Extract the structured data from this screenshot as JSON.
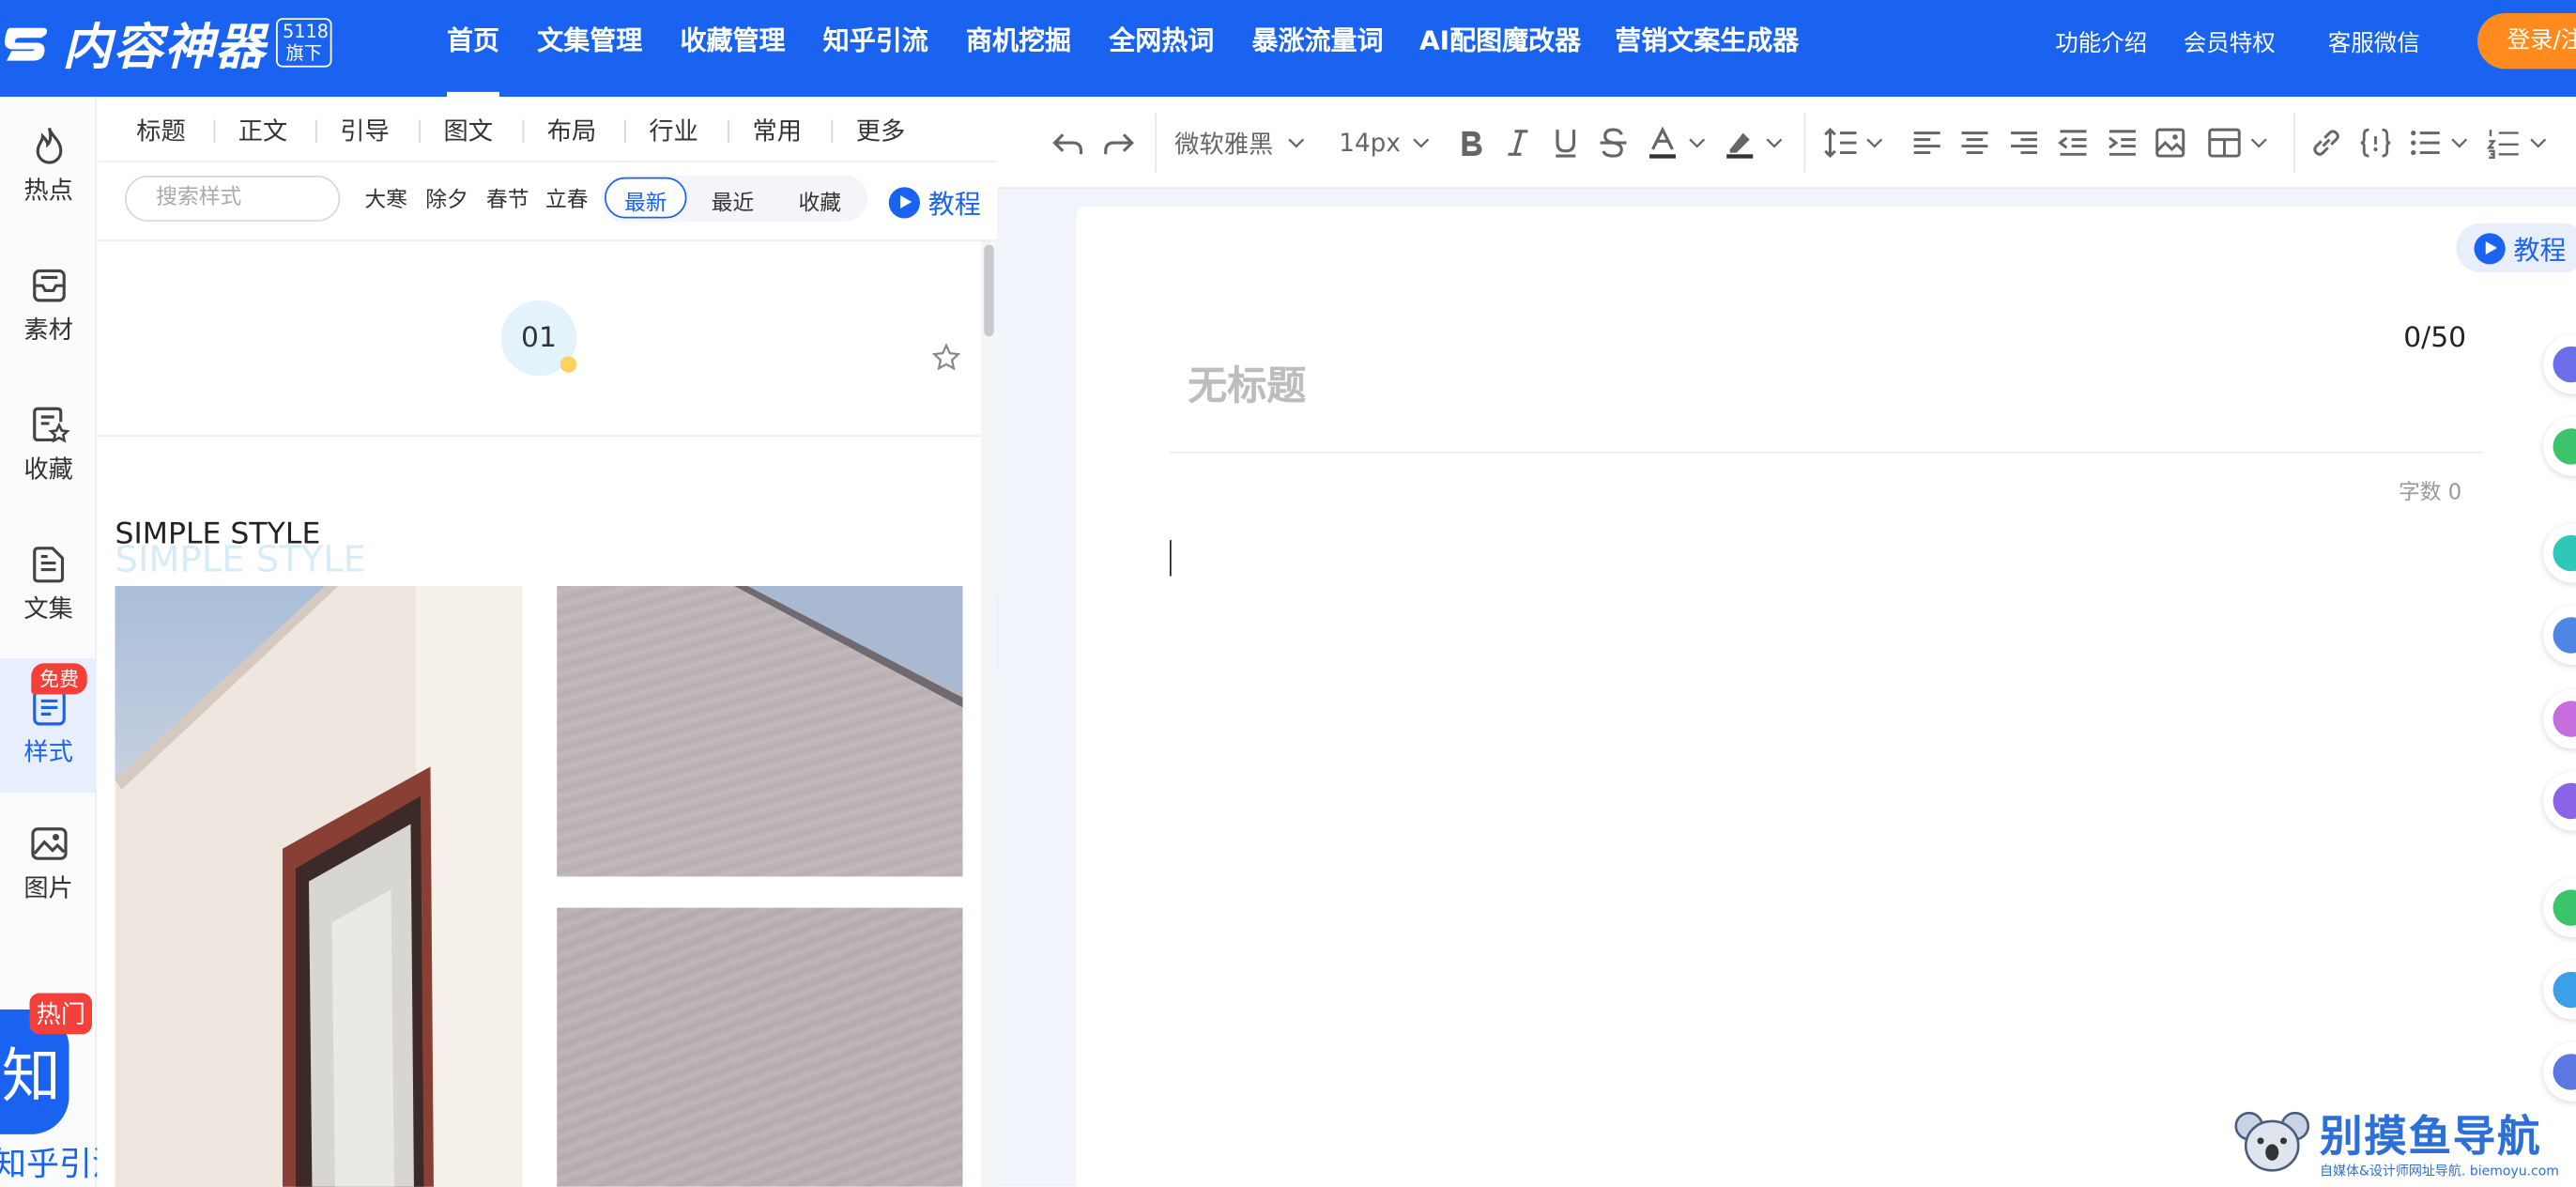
{
  "brand": {
    "logo_text": "内容神器",
    "badge": "5118旗下"
  },
  "topnav": {
    "items": [
      "首页",
      "文集管理",
      "收藏管理",
      "知乎引流",
      "商机挖掘",
      "全网热词",
      "暴涨流量词",
      "AI配图魔改器",
      "营销文案生成器"
    ],
    "active_index": 0,
    "right_links": [
      "功能介绍",
      "会员特权",
      "客服微信"
    ],
    "login_label": "登录/注"
  },
  "sidebar": {
    "items": [
      {
        "label": "热点",
        "icon": "fire-icon"
      },
      {
        "label": "素材",
        "icon": "inbox-icon"
      },
      {
        "label": "收藏",
        "icon": "star-document-icon"
      },
      {
        "label": "文集",
        "icon": "document-icon"
      },
      {
        "label": "样式",
        "icon": "list-document-icon"
      },
      {
        "label": "图片",
        "icon": "image-icon"
      }
    ],
    "active_index": 4,
    "free_badge": "免费",
    "promo": {
      "glyph": "知",
      "hot_badge": "热门",
      "label": "知乎引流"
    }
  },
  "style_panel": {
    "tabs": [
      "标题",
      "正文",
      "引导",
      "图文",
      "布局",
      "行业",
      "常用",
      "更多"
    ],
    "search_placeholder": "搜索样式",
    "tags": [
      "大寒",
      "除夕",
      "春节",
      "立春"
    ],
    "sort": {
      "options": [
        "最新",
        "最近",
        "收藏"
      ],
      "active": "最新"
    },
    "tutorial_label": "教程",
    "cards": [
      {
        "number": "01"
      },
      {
        "title": "SIMPLE STYLE",
        "title_shadow": "SIMPLE STYLE"
      }
    ]
  },
  "toolbar": {
    "font_family": "微软雅黑",
    "font_size": "14px",
    "icons": [
      "undo-icon",
      "redo-icon",
      "bold-icon",
      "italic-icon",
      "underline-icon",
      "strikethrough-icon",
      "font-color-icon",
      "highlight-icon",
      "line-height-icon",
      "align-left-icon",
      "align-center-icon",
      "align-right-icon",
      "outdent-icon",
      "indent-icon",
      "insert-image-icon",
      "table-icon",
      "link-icon",
      "code-icon",
      "bullet-list-icon",
      "numbered-list-icon"
    ]
  },
  "editor": {
    "tutorial_label": "教程",
    "title_placeholder": "无标题",
    "title_count": "0/50",
    "word_count": "字数 0"
  },
  "right_rail": {
    "colors": [
      "#6a6ee8",
      "#3bc46b",
      "#2ec7b8",
      "#4f86e6",
      "#c66ee0",
      "#8b63e6",
      "#3bc46b",
      "#3aa0e8",
      "#5b79e0"
    ]
  },
  "watermark": {
    "title": "别摸鱼导航",
    "subtitle": "自媒体&设计师网址导航. biemoyu.com"
  },
  "colors": {
    "brand_blue": "#1a63f0",
    "login_orange": "#ff8a1e",
    "badge_red": "#f5403a"
  }
}
